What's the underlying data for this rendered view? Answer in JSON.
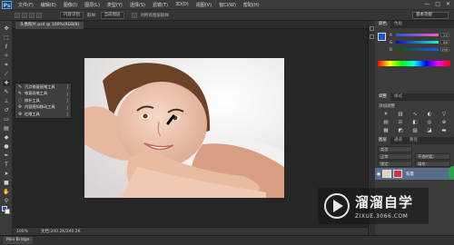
{
  "app": {
    "logo": "Ps"
  },
  "menu": {
    "items": [
      "文件(F)",
      "编辑(E)",
      "图像(I)",
      "图层(L)",
      "类型(Y)",
      "选择(S)",
      "滤镜(T)",
      "3D(D)",
      "视图(V)",
      "窗口(W)",
      "帮助(H)"
    ],
    "window_controls": [
      "—",
      "□",
      "✕"
    ]
  },
  "options_bar": {
    "mode": "内容识别",
    "sample_label": "取样:",
    "sample_value": "当前图层",
    "checkbox_label": "对所有图层取样",
    "workspace": "基本功能"
  },
  "document": {
    "tab_title": "头像照片.psd @ 100%(RGB/8)"
  },
  "toolbar": {
    "icons": [
      "move-icon",
      "marquee-icon",
      "lasso-icon",
      "quick-select-icon",
      "crop-icon",
      "eyedropper-icon",
      "healing-brush-icon",
      "brush-icon",
      "clone-stamp-icon",
      "history-brush-icon",
      "eraser-icon",
      "gradient-icon",
      "blur-icon",
      "dodge-icon",
      "pen-icon",
      "type-icon",
      "path-select-icon",
      "shape-icon",
      "hand-icon",
      "zoom-icon"
    ],
    "foreground_color": "#1b56c4",
    "background_color": "#ffffff"
  },
  "flyout": {
    "items": [
      {
        "label": "污点修复画笔工具",
        "key": "J"
      },
      {
        "label": "修复画笔工具",
        "key": "J"
      },
      {
        "label": "修补工具",
        "key": "J"
      },
      {
        "label": "内容感知移动工具",
        "key": "J"
      },
      {
        "label": "红眼工具",
        "key": "J"
      }
    ]
  },
  "status": {
    "zoom": "100%",
    "doc_size": "文档:240.2K/240.2K"
  },
  "minibridge": {
    "tab": "Mini Bridge"
  },
  "color_panel": {
    "tabs": [
      "颜色",
      "色板"
    ],
    "r_label": "R",
    "r_value": "22",
    "g_label": "G",
    "g_value": "86",
    "b_label": "B",
    "b_value": "196"
  },
  "adjustments_panel": {
    "tabs": [
      "调整",
      "样式"
    ],
    "add_label": "添加调整",
    "icons": [
      "brightness-icon",
      "levels-icon",
      "curves-icon",
      "exposure-icon",
      "vibrance-icon",
      "hue-icon",
      "balance-icon",
      "bw-icon",
      "photo-filter-icon",
      "mixer-icon",
      "lookup-icon",
      "invert-icon",
      "posterize-icon",
      "threshold-icon",
      "gradient-map-icon"
    ]
  },
  "layers_panel": {
    "tabs": [
      "图层",
      "通道",
      "路径"
    ],
    "kind": "类型",
    "blend": "正常",
    "opacity": "不透明度:",
    "lock": "锁定:",
    "fill": "填充:",
    "layer_name": "背景"
  },
  "watermark": {
    "title": "溜溜自学",
    "sub": "ZIXUE.3066.COM"
  }
}
